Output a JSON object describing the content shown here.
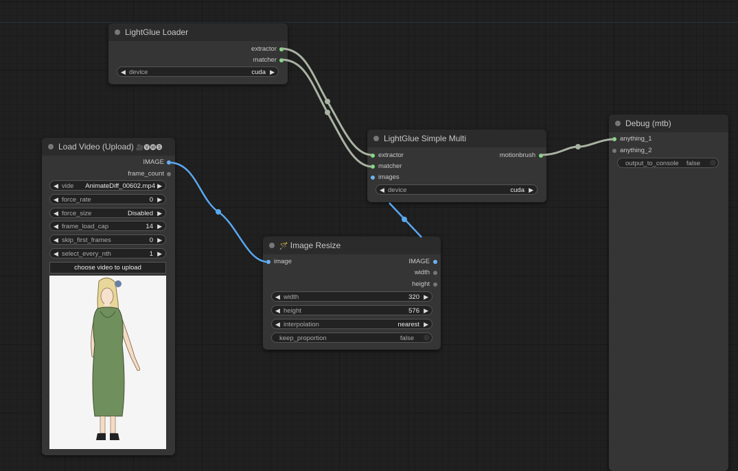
{
  "colors": {
    "canvas": "#202020",
    "node_body": "#353535",
    "node_title": "#2b2b2b",
    "link_image": "#5aa8f0",
    "link_generic": "#a9b3a2",
    "slot_green": "#7de07d",
    "slot_blue": "#6fb0f0"
  },
  "nodes": {
    "lightglue_loader": {
      "title": "LightGlue Loader",
      "outputs": [
        "extractor",
        "matcher"
      ],
      "widgets": {
        "device_label": "device",
        "device_value": "cuda"
      }
    },
    "load_video": {
      "title": "Load Video (Upload)",
      "badge": "🎥🅥🅗🅢",
      "outputs": [
        "IMAGE",
        "frame_count"
      ],
      "widgets": [
        {
          "label": "vide",
          "value": "AnimateDiff_00602.mp4"
        },
        {
          "label": "force_rate",
          "value": "0"
        },
        {
          "label": "force_size",
          "value": "Disabled"
        },
        {
          "label": "frame_load_cap",
          "value": "14"
        },
        {
          "label": "skip_first_frames",
          "value": "0"
        },
        {
          "label": "select_every_nth",
          "value": "1"
        }
      ],
      "upload_button": "choose video to upload"
    },
    "lightglue_simple_multi": {
      "title": "LightGlue Simple Multi",
      "inputs": [
        "extractor",
        "matcher",
        "images"
      ],
      "outputs": [
        "motionbrush"
      ],
      "widgets": {
        "device_label": "device",
        "device_value": "cuda"
      }
    },
    "image_resize": {
      "title": "Image Resize",
      "title_icon": "🪄",
      "inputs": [
        "image"
      ],
      "outputs": [
        "IMAGE",
        "width",
        "height"
      ],
      "widgets": [
        {
          "label": "width",
          "value": "320"
        },
        {
          "label": "height",
          "value": "576"
        },
        {
          "label": "interpolation",
          "value": "nearest"
        }
      ],
      "toggle": {
        "label": "keep_proportion",
        "value": "false"
      }
    },
    "debug": {
      "title": "Debug (mtb)",
      "inputs": [
        "anything_1",
        "anything_2"
      ],
      "toggle": {
        "label": "output_to_console",
        "value": "false"
      }
    }
  }
}
